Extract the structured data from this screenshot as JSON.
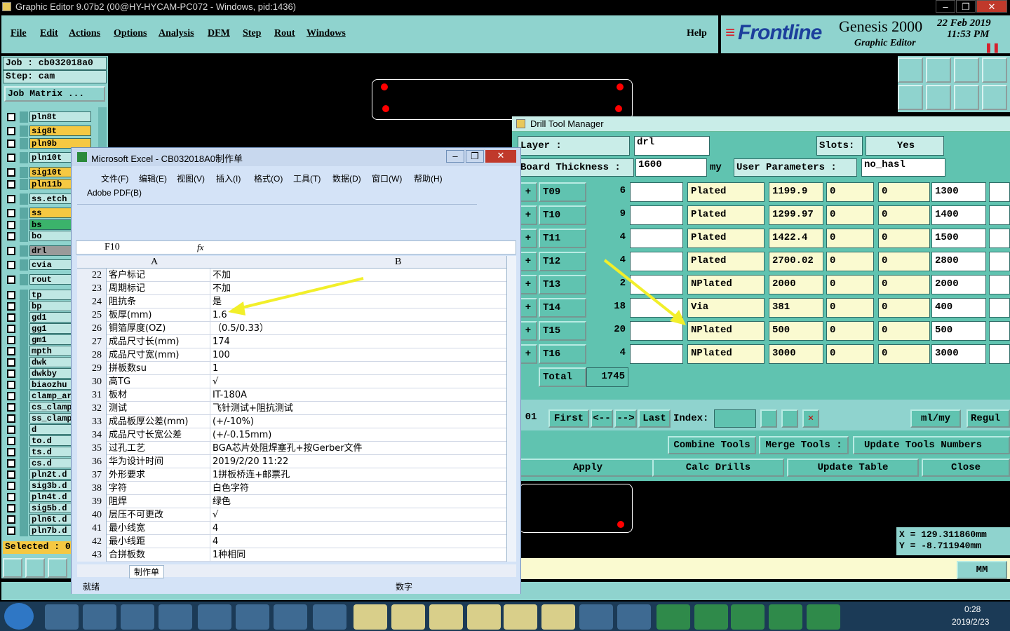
{
  "window_title": "Graphic Editor 9.07b2 (00@HY-HYCAM-PC072 - Windows, pid:1436)",
  "menu": [
    "File",
    "Edit",
    "Actions",
    "Options",
    "Analysis",
    "DFM",
    "Step",
    "Rout",
    "Windows"
  ],
  "help": "Help",
  "logo": {
    "brand": "Frontline",
    "product": "Genesis 2000",
    "sub": "Graphic Editor",
    "date": "22 Feb 2019",
    "time": "11:53 PM"
  },
  "job": {
    "job_label": "Job : cb032018a0",
    "step_label": "Step: cam",
    "matrix_button": "Job Matrix ...",
    "selected": "Selected : 0"
  },
  "layers": [
    {
      "name": "pln8t",
      "color": "#bfe7e3"
    },
    {
      "name": "sig8t",
      "color": "#f5c842"
    },
    {
      "name": "pln9b",
      "color": "#f5c842"
    },
    {
      "name": "pln10t",
      "color": "#bfe7e3"
    },
    {
      "name": "sig10t",
      "color": "#f5c842"
    },
    {
      "name": "pln11b",
      "color": "#f5c842"
    },
    {
      "name": "ss.etch",
      "color": "#bfe7e3"
    },
    {
      "name": "ss",
      "color": "#f5c842"
    },
    {
      "name": "bs",
      "color": "#3bb36b"
    },
    {
      "name": "bo",
      "color": "#bfe7e3"
    },
    {
      "name": "drl",
      "color": "#9a9a9a"
    },
    {
      "name": "cvia",
      "color": "#bfe7e3"
    },
    {
      "name": "rout",
      "color": "#bfe7e3"
    },
    {
      "name": "tp",
      "color": "#bfe7e3"
    },
    {
      "name": "bp",
      "color": "#bfe7e3"
    },
    {
      "name": "gd1",
      "color": "#bfe7e3"
    },
    {
      "name": "gg1",
      "color": "#bfe7e3"
    },
    {
      "name": "gm1",
      "color": "#bfe7e3"
    },
    {
      "name": "mpth",
      "color": "#bfe7e3"
    },
    {
      "name": "dwk",
      "color": "#bfe7e3"
    },
    {
      "name": "dwkby",
      "color": "#bfe7e3"
    },
    {
      "name": "biaozhu",
      "color": "#bfe7e3"
    },
    {
      "name": "clamp_ar",
      "color": "#bfe7e3"
    },
    {
      "name": "cs_clamp",
      "color": "#bfe7e3"
    },
    {
      "name": "ss_clamp",
      "color": "#bfe7e3"
    },
    {
      "name": "d",
      "color": "#bfe7e3"
    },
    {
      "name": "to.d",
      "color": "#bfe7e3"
    },
    {
      "name": "ts.d",
      "color": "#bfe7e3"
    },
    {
      "name": "cs.d",
      "color": "#bfe7e3"
    },
    {
      "name": "pln2t.d",
      "color": "#bfe7e3"
    },
    {
      "name": "sig3b.d",
      "color": "#bfe7e3"
    },
    {
      "name": "pln4t.d",
      "color": "#bfe7e3"
    },
    {
      "name": "sig5b.d",
      "color": "#bfe7e3"
    },
    {
      "name": "pln6t.d",
      "color": "#bfe7e3"
    },
    {
      "name": "pln7b.d",
      "color": "#bfe7e3"
    }
  ],
  "dtm": {
    "title": "Drill Tool Manager",
    "layer_label": "Layer :",
    "layer_value": "drl",
    "slots_label": "Slots:",
    "slots_value": "Yes",
    "thickness_label": "Board Thickness :",
    "thickness_value": "1600",
    "thickness_unit": "my",
    "user_params_label": "User Parameters :",
    "user_params_value": "no_hasl",
    "rows": [
      {
        "tool": "T09",
        "count": "6",
        "type": "Plated",
        "size": "1199.9",
        "p1": "0",
        "p2": "0",
        "finish": "1300"
      },
      {
        "tool": "T10",
        "count": "9",
        "type": "Plated",
        "size": "1299.97",
        "p1": "0",
        "p2": "0",
        "finish": "1400"
      },
      {
        "tool": "T11",
        "count": "4",
        "type": "Plated",
        "size": "1422.4",
        "p1": "0",
        "p2": "0",
        "finish": "1500"
      },
      {
        "tool": "T12",
        "count": "4",
        "type": "Plated",
        "size": "2700.02",
        "p1": "0",
        "p2": "0",
        "finish": "2800"
      },
      {
        "tool": "T13",
        "count": "2",
        "type": "NPlated",
        "size": "2000",
        "p1": "0",
        "p2": "0",
        "finish": "2000"
      },
      {
        "tool": "T14",
        "count": "18",
        "type": "Via",
        "size": "381",
        "p1": "0",
        "p2": "0",
        "finish": "400"
      },
      {
        "tool": "T15",
        "count": "20",
        "type": "NPlated",
        "size": "500",
        "p1": "0",
        "p2": "0",
        "finish": "500"
      },
      {
        "tool": "T16",
        "count": "4",
        "type": "NPlated",
        "size": "3000",
        "p1": "0",
        "p2": "0",
        "finish": "3000"
      }
    ],
    "total_label": "Total",
    "total_value": "1745",
    "nav": {
      "prefix": "01",
      "first": "First",
      "prev": "<--",
      "next": "-->",
      "last": "Last",
      "index": "Index:",
      "units": "ml/my",
      "regular": "Regul"
    },
    "combine": "Combine Tools",
    "merge": "Merge Tools :",
    "update_numbers": "Update Tools Numbers",
    "apply": "Apply",
    "calc": "Calc Drills",
    "update_table": "Update Table",
    "close": "Close"
  },
  "coords": {
    "x": "X = 129.311860mm",
    "y": "Y = -8.711940mm",
    "unit": "MM"
  },
  "excel": {
    "title": "Microsoft Excel - CB032018A0制作单",
    "menu": [
      "文件(F)",
      "编辑(E)",
      "视图(V)",
      "插入(I)",
      "格式(O)",
      "工具(T)",
      "数据(D)",
      "窗口(W)",
      "帮助(H)"
    ],
    "adobe": "Adobe PDF(B)",
    "name_box": "F10",
    "fx": "fx",
    "col_a": "A",
    "col_b": "B",
    "rows": [
      {
        "n": "22",
        "a": "客户标记",
        "b": "不加"
      },
      {
        "n": "23",
        "a": "周期标记",
        "b": "不加"
      },
      {
        "n": "24",
        "a": "阻抗条",
        "b": "是"
      },
      {
        "n": "25",
        "a": "板厚(mm)",
        "b": "1.6"
      },
      {
        "n": "26",
        "a": "铜箔厚度(OZ)",
        "b": "（0.5/0.33）"
      },
      {
        "n": "27",
        "a": "成品尺寸长(mm)",
        "b": "174"
      },
      {
        "n": "28",
        "a": "成品尺寸宽(mm)",
        "b": "100"
      },
      {
        "n": "29",
        "a": "拼板数su",
        "b": "1"
      },
      {
        "n": "30",
        "a": "高TG",
        "b": "√"
      },
      {
        "n": "31",
        "a": "板材",
        "b": "IT-180A"
      },
      {
        "n": "32",
        "a": "测试",
        "b": "飞针测试+阻抗测试"
      },
      {
        "n": "33",
        "a": "成品板厚公差(mm)",
        "b": "(+/-10%)"
      },
      {
        "n": "34",
        "a": "成品尺寸长宽公差",
        "b": "(+/-0.15mm)"
      },
      {
        "n": "35",
        "a": "过孔工艺",
        "b": "BGA芯片处阻焊塞孔+按Gerber文件"
      },
      {
        "n": "36",
        "a": "华为设计时间",
        "b": "2019/2/20 11:22"
      },
      {
        "n": "37",
        "a": "外形要求",
        "b": "1拼板桥连+邮票孔"
      },
      {
        "n": "38",
        "a": "字符",
        "b": "白色字符"
      },
      {
        "n": "39",
        "a": "阻焊",
        "b": "绿色"
      },
      {
        "n": "40",
        "a": "层压不可更改",
        "b": "√"
      },
      {
        "n": "41",
        "a": "最小线宽",
        "b": "4"
      },
      {
        "n": "42",
        "a": "最小线距",
        "b": "4"
      },
      {
        "n": "43",
        "a": "合拼板数",
        "b": "1种相同"
      }
    ],
    "sheet_tab": "制作单",
    "status": "就绪",
    "num": "数字"
  },
  "taskbar": {
    "time": "0:28",
    "date": "2019/2/23"
  }
}
